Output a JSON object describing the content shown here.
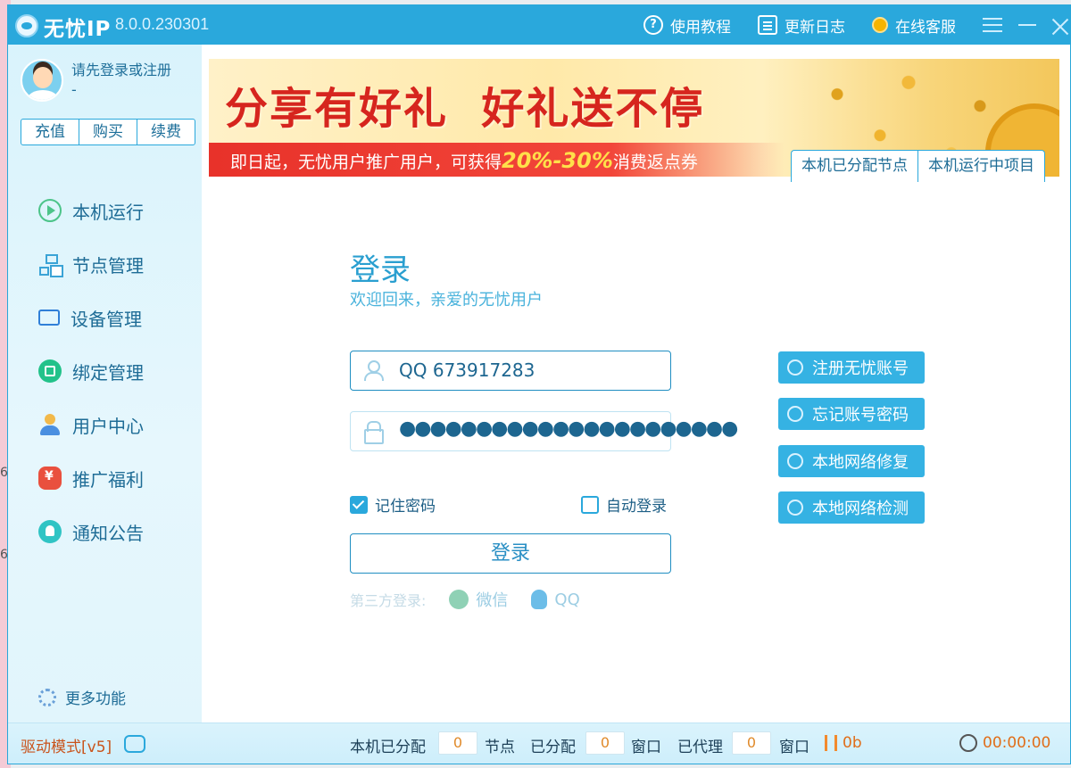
{
  "app": {
    "name": "无忧IP",
    "version": "8.0.0.230301"
  },
  "titlebar": {
    "tutorial": "使用教程",
    "changelog": "更新日志",
    "support": "在线客服"
  },
  "user": {
    "prompt": "请先登录或注册",
    "prompt_sub": "-",
    "buttons": [
      "充值",
      "购买",
      "续费"
    ]
  },
  "sidebar": {
    "items": [
      {
        "label": "本机运行",
        "icon": "play-circle-icon"
      },
      {
        "label": "节点管理",
        "icon": "network-nodes-icon"
      },
      {
        "label": "设备管理",
        "icon": "device-icon"
      },
      {
        "label": "绑定管理",
        "icon": "bind-icon"
      },
      {
        "label": "用户中心",
        "icon": "user-icon"
      },
      {
        "label": "推广福利",
        "icon": "gift-money-icon"
      },
      {
        "label": "通知公告",
        "icon": "bell-icon"
      }
    ],
    "more": "更多功能"
  },
  "banner": {
    "slogan": "分享有好礼  好礼送不停",
    "strip_prefix": "即日起，无忧用户推广用户，可获得",
    "strip_highlight": "20%-30%",
    "strip_suffix": "消费返点券"
  },
  "tabs": [
    "本机已分配节点",
    "本机运行中项目"
  ],
  "login": {
    "title": "登录",
    "subtitle": "欢迎回来，亲爱的无忧用户",
    "username_value": "QQ 673917283",
    "password_mask": "●●●●●●●●●●●●●●●●●●●●●●",
    "remember": "记住密码",
    "remember_checked": true,
    "auto_login": "自动登录",
    "auto_login_checked": false,
    "submit": "登录",
    "third_party_label": "第三方登录:",
    "wechat": "微信",
    "qq": "QQ"
  },
  "side_actions": [
    "注册无忧账号",
    "忘记账号密码",
    "本地网络修复",
    "本地网络检测"
  ],
  "status": {
    "drive_mode": "驱动模式[v5]",
    "allocated_label": "本机已分配",
    "allocated_value": "0",
    "nodes_label": "节点",
    "assigned_label": "已分配",
    "assigned_value": "0",
    "window_label": "窗口",
    "proxied_label": "已代理",
    "proxied_value": "0",
    "window_label2": "窗口",
    "speed": "0b",
    "timer": "00:00:00"
  },
  "colors": {
    "accent": "#2aa8dc",
    "banner_red": "#d6251e",
    "status_orange": "#e06e1a"
  }
}
